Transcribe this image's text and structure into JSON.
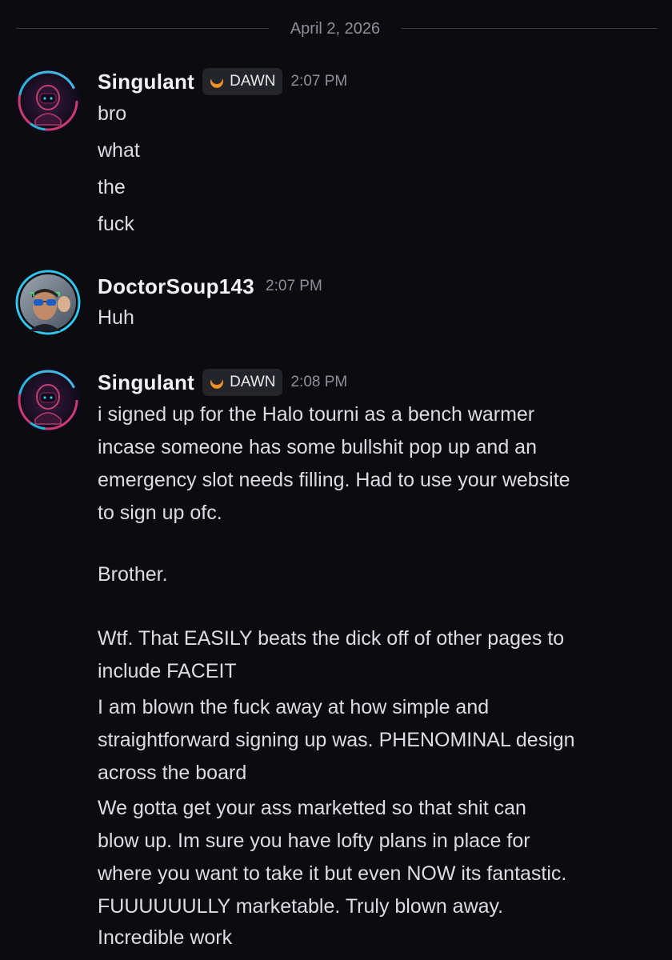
{
  "date_divider": "April 2, 2026",
  "messages": [
    {
      "username": "Singulant",
      "badge": "DAWN",
      "timestamp": "2:07 PM",
      "lines": [
        "bro",
        "what",
        "the",
        "fuck"
      ]
    },
    {
      "username": "DoctorSoup143",
      "timestamp": "2:07 PM",
      "lines": [
        "Huh"
      ]
    },
    {
      "username": "Singulant",
      "badge": "DAWN",
      "timestamp": "2:08 PM",
      "lines": [
        "i signed up for the Halo tourni as a bench warmer",
        "incase someone has some bullshit pop up and an",
        "emergency slot needs filling. Had to use your website",
        "to sign up ofc.",
        "Brother.",
        "Wtf. That EASILY beats the dick off of other pages to",
        "include FACEIT",
        "I am blown the fuck away at how simple and",
        "straightforward signing up was. PHENOMINAL design",
        "across the board",
        "We gotta get your ass marketted so that shit can",
        "blow up. Im sure you have lofty plans in place for",
        "where you want to take it but even NOW its fantastic.",
        "FUUUUUULLY marketable. Truly blown away.",
        "Incredible work"
      ]
    }
  ],
  "colors": {
    "background": "#0b0b10",
    "text": "#dcdde4",
    "username": "#f2f3f5",
    "muted": "#8e909a",
    "badge_bg": "#24252b",
    "badge_icon": "#f0902a",
    "avatar_ring_cyan": "#2ec8f0",
    "avatar_ring_pink": "#e0407a"
  },
  "icons": {
    "singulant_avatar": "astronaut-avatar-icon",
    "doctorsoup_avatar": "user-photo-avatar",
    "badge": "dawn-crescent-icon"
  }
}
